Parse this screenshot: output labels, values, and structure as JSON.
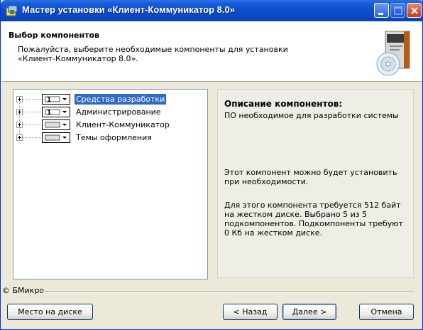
{
  "window": {
    "title": "Мастер установки «Клиент-Коммуникатор 8.0»",
    "icons": {
      "app": "installer-icon",
      "minimize": "minimize-icon",
      "maximize": "maximize-icon",
      "close": "close-icon"
    }
  },
  "header": {
    "title": "Выбор компонентов",
    "description_line1": "Пожалуйста, выберите необходимые компоненты для установки",
    "description_line2": "«Клиент-Коммуникатор 8.0».",
    "image_icon": "software-box-icon"
  },
  "tree": {
    "items": [
      {
        "label": "Средства разработки",
        "selected": true,
        "drive_icon": "component-drive-icon"
      },
      {
        "label": "Администрирование",
        "selected": false,
        "drive_icon": "component-drive-icon"
      },
      {
        "label": "Клиент-Коммуникатор",
        "selected": false,
        "drive_icon": "component-drive-icon"
      },
      {
        "label": "Темы оформления",
        "selected": false,
        "drive_icon": "component-drive-icon"
      }
    ]
  },
  "description": {
    "title": "Описание компонентов:",
    "text": "ПО необходимое для разработки системы",
    "install_note_line1": "Этот компонент можно будет установить",
    "install_note_line2": "при необходимости.",
    "space_line1": "Для этого компонента требуется 512 байт",
    "space_line2": "на жестком диске. Выбрано 5 из 5",
    "space_line3": "подкомпонентов. Подкомпоненты требуют",
    "space_line4": "0 Кб на жестком диске."
  },
  "footer": {
    "brand": "© БМикро",
    "disk_space_button": "Место на диске",
    "back_button": "< Назад",
    "next_button": "Далее >",
    "cancel_button": "Отмена"
  },
  "colors": {
    "titlebar": "#0b4ed0",
    "selection": "#316ac5",
    "window_bg": "#ece9d8"
  }
}
